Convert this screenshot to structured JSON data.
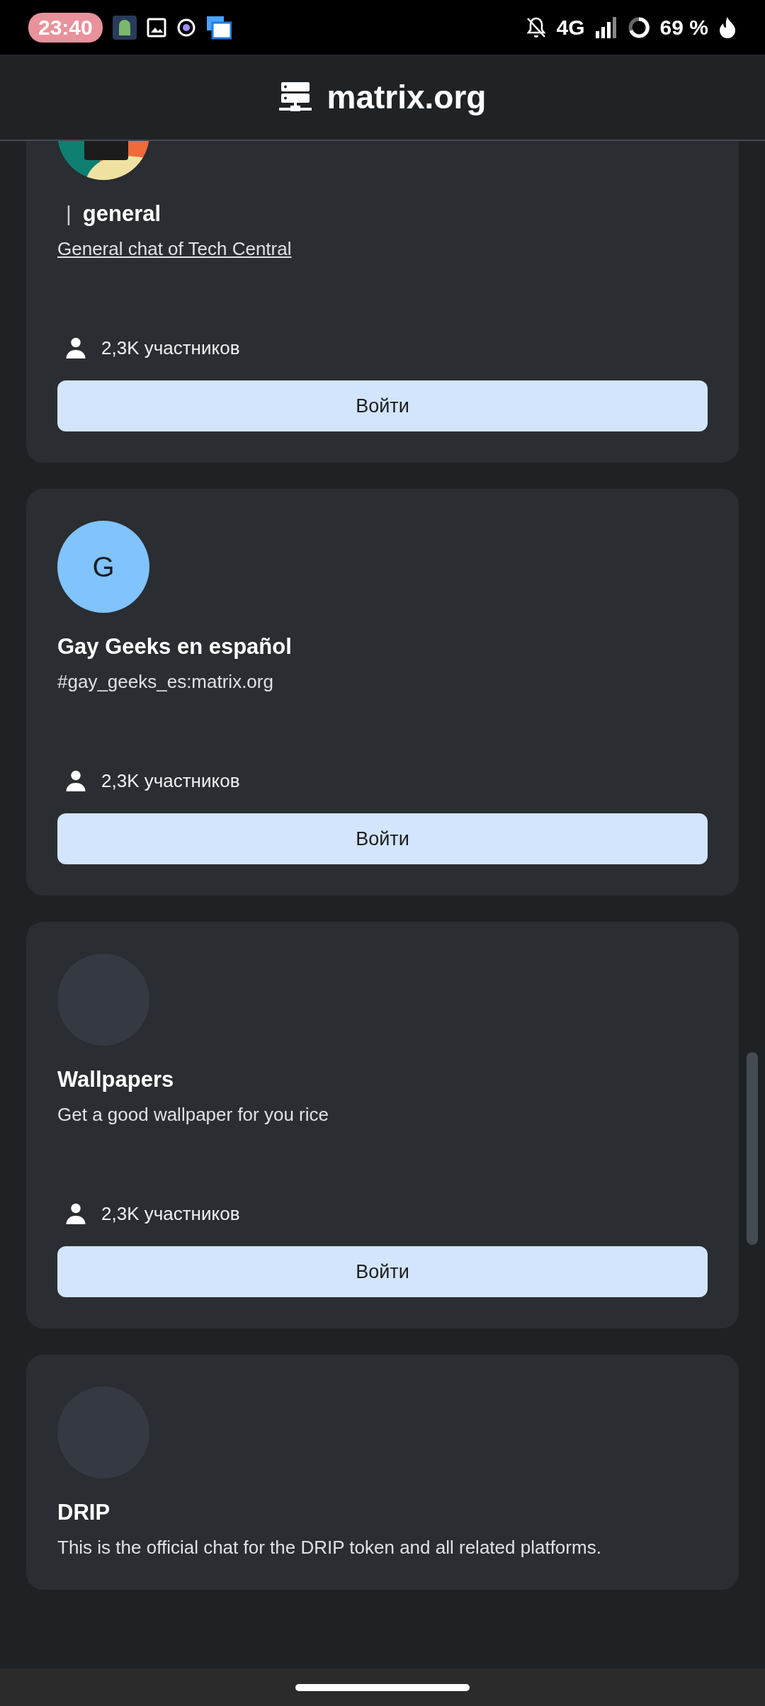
{
  "status_bar": {
    "time": "23:40",
    "network": "4G",
    "battery": "69 %"
  },
  "header": {
    "title": "matrix.org"
  },
  "rooms": [
    {
      "name_prefix": "|",
      "name": "general",
      "topic": "General chat of Tech Central",
      "topic_link": true,
      "members": "2,3K участников",
      "join": "Войти"
    },
    {
      "avatar": {
        "kind": "letter",
        "letter": "G",
        "color": "#80c3fd"
      },
      "name": "Gay Geeks en español",
      "topic": "#gay_geeks_es:matrix.org",
      "topic_link": false,
      "members": "2,3K участников",
      "join": "Войти"
    },
    {
      "avatar": {
        "kind": "empty"
      },
      "name": "Wallpapers",
      "topic": "Get a good wallpaper for you rice",
      "topic_link": false,
      "members": "2,3K участников",
      "join": "Войти"
    },
    {
      "avatar": {
        "kind": "empty"
      },
      "name": "DRIP",
      "topic": "This is the official chat for the DRIP token and all related platforms.",
      "topic_link": false
    }
  ]
}
